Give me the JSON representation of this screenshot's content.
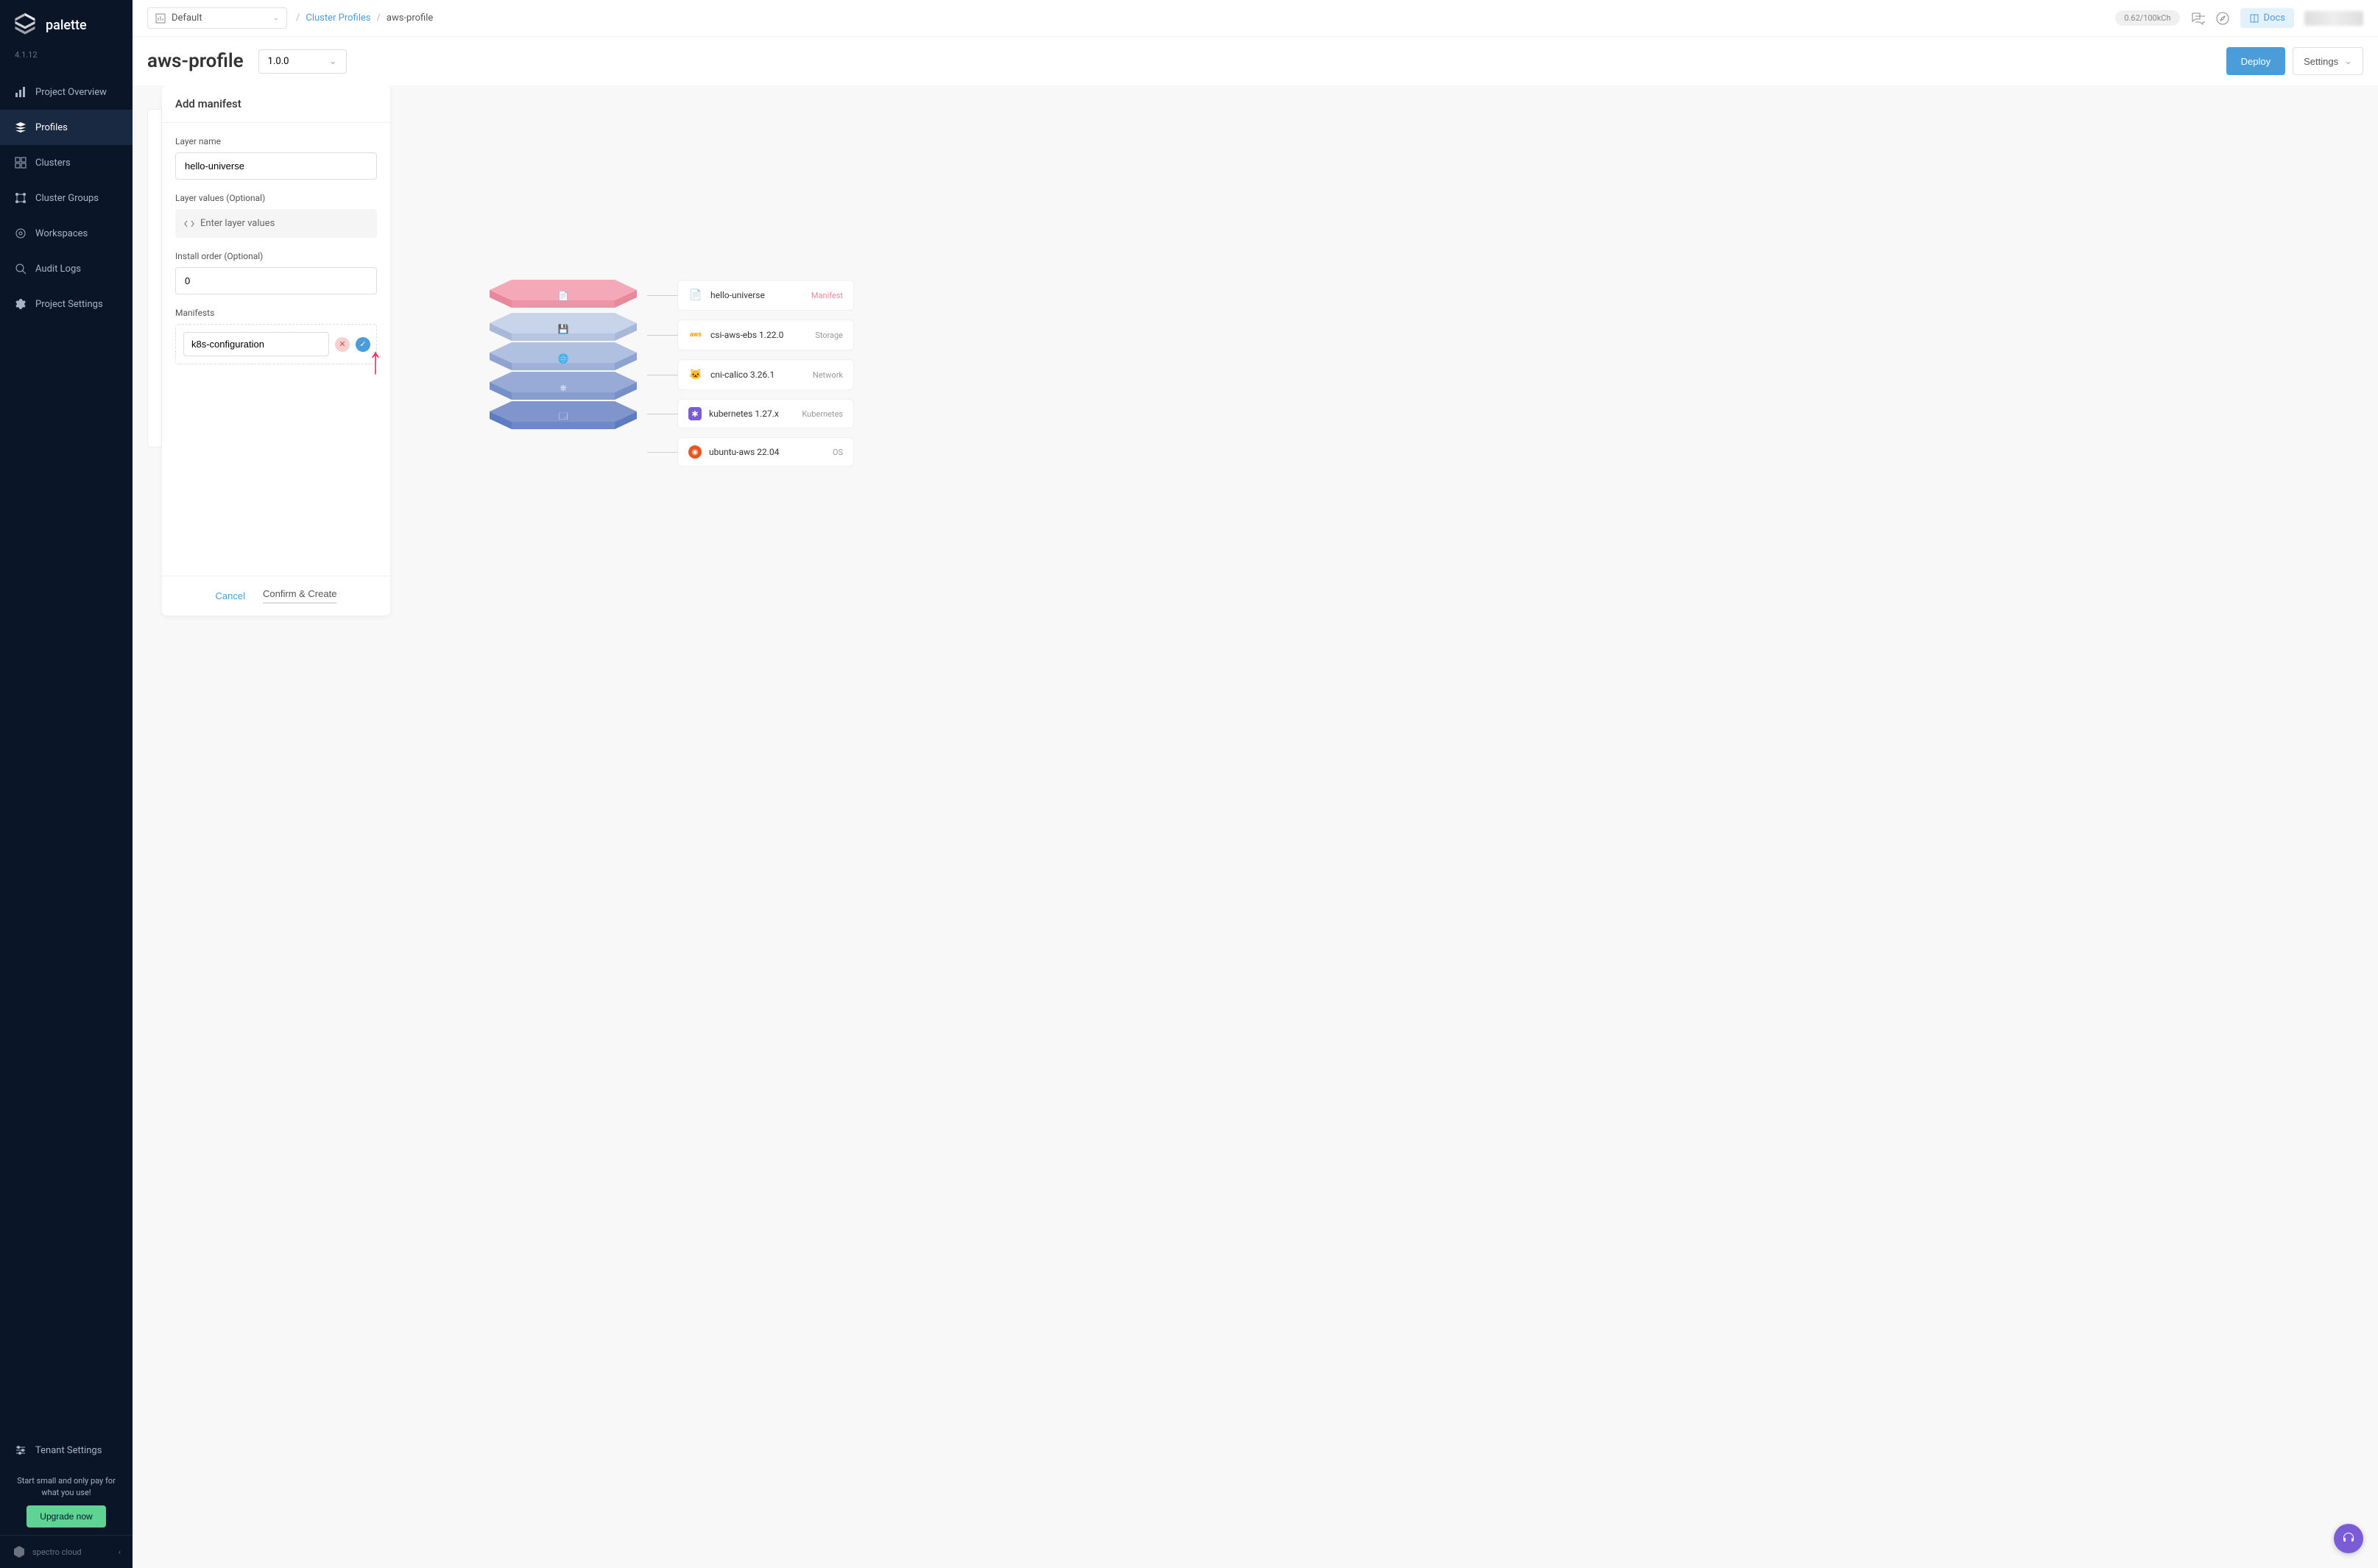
{
  "app": {
    "name": "palette",
    "version": "4.1.12",
    "footer_brand": "spectro cloud"
  },
  "sidebar": {
    "items": [
      {
        "label": "Project Overview"
      },
      {
        "label": "Profiles"
      },
      {
        "label": "Clusters"
      },
      {
        "label": "Cluster Groups"
      },
      {
        "label": "Workspaces"
      },
      {
        "label": "Audit Logs"
      },
      {
        "label": "Project Settings"
      }
    ],
    "tenant_settings": "Tenant Settings",
    "upgrade_text": "Start small and only pay for what you use!",
    "upgrade_button": "Upgrade now"
  },
  "header": {
    "scope": "Default",
    "breadcrumb_link": "Cluster Profiles",
    "breadcrumb_current": "aws-profile",
    "usage": "0.62/100kCh",
    "docs": "Docs"
  },
  "subheader": {
    "title": "aws-profile",
    "version": "1.0.0",
    "deploy": "Deploy",
    "settings": "Settings"
  },
  "manifest": {
    "title": "Add manifest",
    "layer_name_label": "Layer name",
    "layer_name_value": "hello-universe",
    "layer_values_label": "Layer values (Optional)",
    "layer_values_placeholder": "Enter layer values",
    "install_order_label": "Install order (Optional)",
    "install_order_value": "0",
    "manifests_label": "Manifests",
    "manifest_name": "k8s-configuration",
    "cancel": "Cancel",
    "confirm_create": "Confirm & Create"
  },
  "layers": [
    {
      "name": "hello-universe",
      "type": "Manifest",
      "icon": "📄",
      "color_top": "#f5a8b8",
      "color_side": "#e8889b"
    },
    {
      "name": "csi-aws-ebs 1.22.0",
      "type": "Storage",
      "icon_text": "aws",
      "color_top": "#c8d4ea",
      "color_side": "#a8b8d8"
    },
    {
      "name": "cni-calico 3.26.1",
      "type": "Network",
      "icon": "🐱",
      "color_top": "#b0c0e0",
      "color_side": "#8fa3d0"
    },
    {
      "name": "kubernetes 1.27.x",
      "type": "Kubernetes",
      "icon": "⎈",
      "color_top": "#98aad6",
      "color_side": "#7690c8"
    },
    {
      "name": "ubuntu-aws 22.04",
      "type": "OS",
      "icon": "🟠",
      "color_top": "#8095cc",
      "color_side": "#5d7dc0"
    }
  ]
}
